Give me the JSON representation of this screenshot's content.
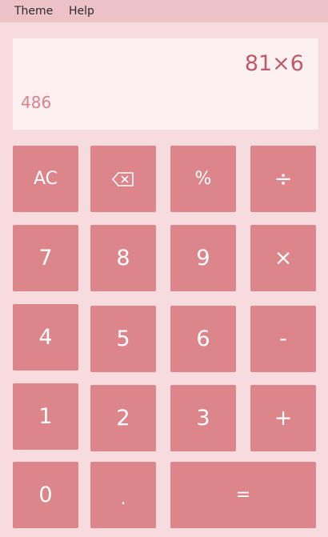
{
  "menu": {
    "theme_label": "Theme",
    "help_label": "Help"
  },
  "display": {
    "expression": "81×6",
    "result": "486"
  },
  "keys": {
    "ac": "AC",
    "backspace_icon": "backspace-icon",
    "percent": "%",
    "divide": "÷",
    "seven": "7",
    "eight": "8",
    "nine": "9",
    "multiply": "×",
    "four": "4",
    "five": "5",
    "six": "6",
    "minus": "-",
    "one": "1",
    "two": "2",
    "three": "3",
    "plus": "+",
    "zero": "0",
    "decimal": ".",
    "equals": "="
  },
  "colors": {
    "background": "#f6dcdf",
    "menubar": "#eec3c8",
    "display_background": "#fdf0f1",
    "expression_text": "#c0586b",
    "result_text": "#d9828a",
    "key_background": "#dc858b",
    "key_text": "#ffffff"
  }
}
